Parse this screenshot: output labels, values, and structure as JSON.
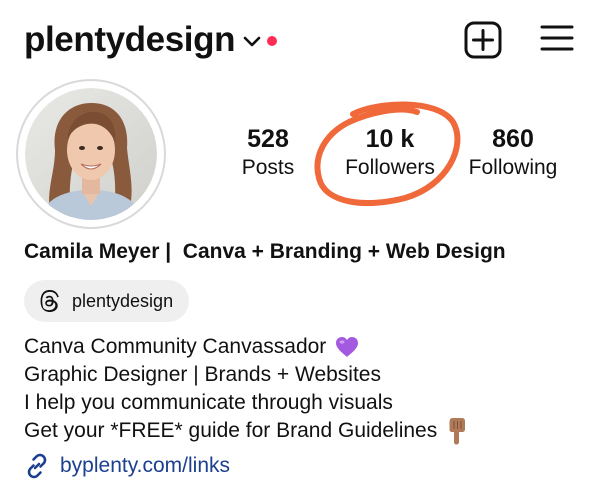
{
  "header": {
    "username": "plentydesign",
    "username_chevron_icon": "chevron-down-icon",
    "notification_dot_color": "#ff2d55",
    "new_post_icon": "plus-square-icon",
    "menu_icon": "hamburger-menu-icon"
  },
  "profile": {
    "avatar_icon": "profile-photo",
    "stats": [
      {
        "value": "528",
        "label": "Posts"
      },
      {
        "value": "10 k",
        "label": "Followers"
      },
      {
        "value": "860",
        "label": "Following"
      }
    ],
    "highlight_color": "#f0693a",
    "name_line": "Camila Meyer |  Canva + Branding + Web Design"
  },
  "threads_badge": {
    "icon": "threads-icon",
    "handle": "plentydesign"
  },
  "bio": {
    "lines": [
      "Canva Community Canvassador",
      "Graphic Designer | Brands + Websites",
      "I help you communicate through visuals",
      "Get your *FREE* guide for Brand Guidelines"
    ],
    "line1_emoji": "purple-heart-icon",
    "line4_emoji": "pointing-down-icon"
  },
  "link": {
    "icon": "link-icon",
    "text": "byplenty.com/links",
    "color": "#1c3f8f"
  }
}
